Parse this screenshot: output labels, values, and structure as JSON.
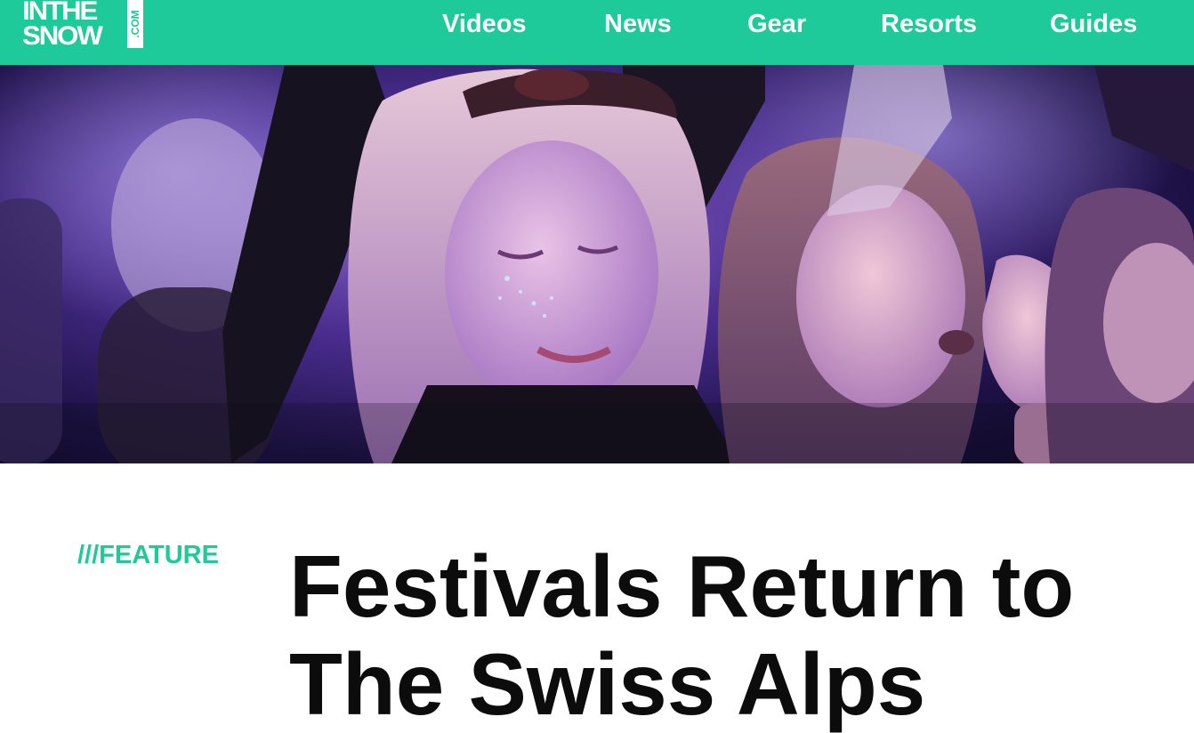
{
  "site": {
    "logo_line1": "INTHE",
    "logo_line2": "SNOW",
    "logo_suffix": ".COM",
    "brand_color": "#1ec99a"
  },
  "nav": {
    "items": [
      {
        "label": "Videos"
      },
      {
        "label": "News"
      },
      {
        "label": "Gear"
      },
      {
        "label": "Resorts"
      },
      {
        "label": "Guides"
      }
    ]
  },
  "hero": {
    "subject": "crowd-at-music-festival-photo"
  },
  "article": {
    "kicker": "///FEATURE",
    "title": "Festivals Return to The Swiss Alps"
  }
}
